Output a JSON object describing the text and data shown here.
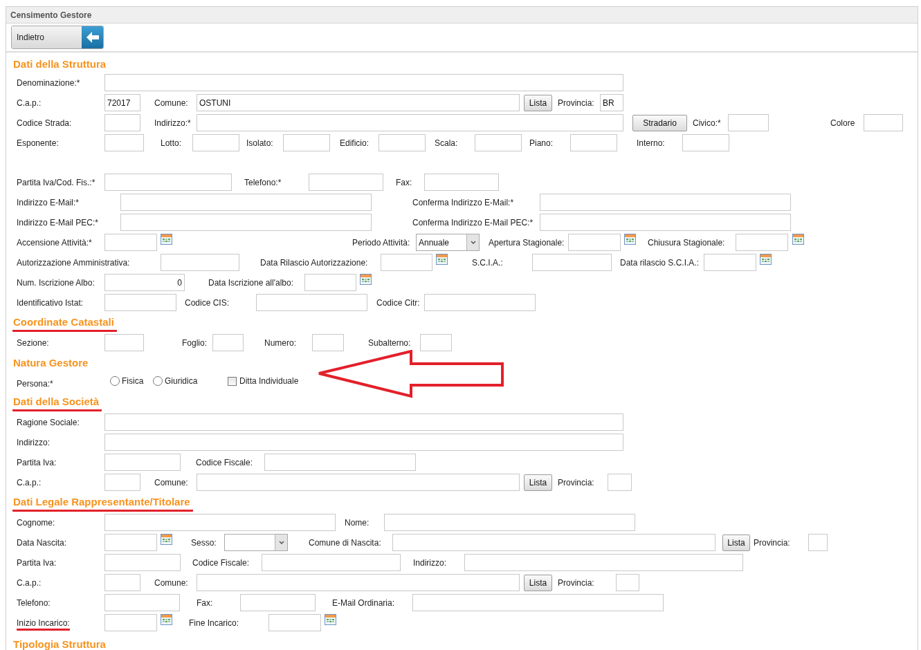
{
  "window": {
    "title": "Censimento Gestore"
  },
  "toolbar": {
    "back_button": "Indietro"
  },
  "sections": [
    {
      "title": "Dati della Struttura",
      "underlined": false,
      "rows": [
        {
          "items": [
            {
              "kind": "label",
              "text": "Denominazione:*",
              "underlined": false
            },
            {
              "kind": "input"
            }
          ]
        },
        {
          "items": [
            {
              "kind": "label",
              "text": "C.a.p.:",
              "underlined": false
            },
            {
              "kind": "input",
              "value": "72017"
            },
            {
              "kind": "label",
              "text": "Comune:",
              "underlined": false
            },
            {
              "kind": "input",
              "value": "OSTUNI"
            },
            {
              "kind": "button",
              "label": "Lista"
            },
            {
              "kind": "label",
              "text": "Provincia:",
              "underlined": false
            },
            {
              "kind": "input",
              "value": "BR"
            }
          ]
        },
        {
          "items": [
            {
              "kind": "label",
              "text": "Codice Strada:",
              "underlined": false
            },
            {
              "kind": "input"
            },
            {
              "kind": "label",
              "text": "Indirizzo:*",
              "underlined": false
            },
            {
              "kind": "input"
            },
            {
              "kind": "button",
              "label": "Stradario"
            },
            {
              "kind": "label",
              "text": "Civico:*",
              "underlined": false
            },
            {
              "kind": "input"
            },
            {
              "kind": "label",
              "text": "Colore",
              "underlined": false
            },
            {
              "kind": "input"
            }
          ]
        },
        {
          "items": [
            {
              "kind": "label",
              "text": "Esponente:",
              "underlined": false
            },
            {
              "kind": "input"
            },
            {
              "kind": "label",
              "text": "Lotto:",
              "underlined": false
            },
            {
              "kind": "input"
            },
            {
              "kind": "label",
              "text": "Isolato:",
              "underlined": false
            },
            {
              "kind": "input"
            },
            {
              "kind": "label",
              "text": "Edificio:",
              "underlined": false
            },
            {
              "kind": "input"
            },
            {
              "kind": "label",
              "text": "Scala:",
              "underlined": false
            },
            {
              "kind": "input"
            },
            {
              "kind": "label",
              "text": "Piano:",
              "underlined": false
            },
            {
              "kind": "input"
            },
            {
              "kind": "label",
              "text": "Interno:",
              "underlined": false
            },
            {
              "kind": "input"
            }
          ]
        },
        {
          "items": [
            {
              "kind": "label",
              "text": "Partita Iva/Cod. Fis.:*",
              "underlined": false
            },
            {
              "kind": "input"
            },
            {
              "kind": "label",
              "text": "Telefono:*",
              "underlined": false
            },
            {
              "kind": "input"
            },
            {
              "kind": "label",
              "text": "Fax:",
              "underlined": false
            },
            {
              "kind": "input"
            }
          ]
        },
        {
          "items": [
            {
              "kind": "label",
              "text": "Indirizzo E-Mail:*",
              "underlined": false
            },
            {
              "kind": "input"
            },
            {
              "kind": "label",
              "text": "Conferma Indirizzo E-Mail:*",
              "underlined": false
            },
            {
              "kind": "input"
            }
          ]
        },
        {
          "items": [
            {
              "kind": "label",
              "text": "Indirizzo E-Mail PEC:*",
              "underlined": false
            },
            {
              "kind": "input"
            },
            {
              "kind": "label",
              "text": "Conferma Indirizzo E-Mail PEC:*",
              "underlined": false
            },
            {
              "kind": "input"
            }
          ]
        },
        {
          "items": [
            {
              "kind": "label",
              "text": "Accensione Attività:*",
              "underlined": false
            },
            {
              "kind": "input"
            },
            {
              "kind": "calendar"
            },
            {
              "kind": "label",
              "text": "Periodo Attività:",
              "underlined": false
            },
            {
              "kind": "select",
              "value": "Annuale"
            },
            {
              "kind": "label",
              "text": "Apertura Stagionale:",
              "underlined": false
            },
            {
              "kind": "input"
            },
            {
              "kind": "calendar"
            },
            {
              "kind": "label",
              "text": "Chiusura Stagionale:",
              "underlined": false
            },
            {
              "kind": "input"
            },
            {
              "kind": "calendar"
            }
          ]
        },
        {
          "items": [
            {
              "kind": "label",
              "text": "Autorizzazione Amministrativa:",
              "underlined": false
            },
            {
              "kind": "input"
            },
            {
              "kind": "label",
              "text": "Data Rilascio Autorizzazione:",
              "underlined": false
            },
            {
              "kind": "input"
            },
            {
              "kind": "calendar"
            },
            {
              "kind": "label",
              "text": "S.C.I.A.:",
              "underlined": false
            },
            {
              "kind": "input"
            },
            {
              "kind": "label",
              "text": "Data rilascio S.C.I.A.:",
              "underlined": false
            },
            {
              "kind": "input"
            },
            {
              "kind": "calendar"
            }
          ]
        },
        {
          "items": [
            {
              "kind": "label",
              "text": "Num. Iscrizione Albo:",
              "underlined": false
            },
            {
              "kind": "input",
              "value": "0",
              "numeric": true
            },
            {
              "kind": "label",
              "text": "Data Iscrizione all'albo:",
              "underlined": false
            },
            {
              "kind": "input"
            },
            {
              "kind": "calendar"
            }
          ]
        },
        {
          "items": [
            {
              "kind": "label",
              "text": "Identificativo Istat:",
              "underlined": false
            },
            {
              "kind": "input"
            },
            {
              "kind": "label",
              "text": "Codice CIS:",
              "underlined": false
            },
            {
              "kind": "input"
            },
            {
              "kind": "label",
              "text": "Codice Citr:",
              "underlined": false
            },
            {
              "kind": "input"
            }
          ]
        }
      ]
    },
    {
      "title": "Coordinate Catastali",
      "underlined": true,
      "rows": [
        {
          "items": [
            {
              "kind": "label",
              "text": "Sezione:",
              "underlined": false
            },
            {
              "kind": "input"
            },
            {
              "kind": "label",
              "text": "Foglio:",
              "underlined": false
            },
            {
              "kind": "input"
            },
            {
              "kind": "label",
              "text": "Numero:",
              "underlined": false
            },
            {
              "kind": "input"
            },
            {
              "kind": "label",
              "text": "Subalterno:",
              "underlined": false
            },
            {
              "kind": "input"
            }
          ]
        }
      ]
    },
    {
      "title": "Natura Gestore",
      "underlined": false,
      "rows": [
        {
          "pointer_arrow": true,
          "items": [
            {
              "kind": "label",
              "text": "Persona:*",
              "underlined": false
            },
            {
              "kind": "radio",
              "label": "Fisica",
              "selected": false
            },
            {
              "kind": "radio",
              "label": "Giuridica",
              "selected": false
            },
            {
              "kind": "checkbox",
              "label": "Ditta Individuale",
              "checked": false
            }
          ]
        }
      ]
    },
    {
      "title": "Dati della Società",
      "underlined": true,
      "rows": [
        {
          "items": [
            {
              "kind": "label",
              "text": "Ragione Sociale:",
              "underlined": false
            },
            {
              "kind": "input"
            }
          ]
        },
        {
          "items": [
            {
              "kind": "label",
              "text": "Indirizzo:",
              "underlined": false
            },
            {
              "kind": "input"
            }
          ]
        },
        {
          "items": [
            {
              "kind": "label",
              "text": "Partita Iva:",
              "underlined": false
            },
            {
              "kind": "input"
            },
            {
              "kind": "label",
              "text": "Codice Fiscale:",
              "underlined": false
            },
            {
              "kind": "input"
            }
          ]
        },
        {
          "items": [
            {
              "kind": "label",
              "text": "C.a.p.:",
              "underlined": false
            },
            {
              "kind": "input"
            },
            {
              "kind": "label",
              "text": "Comune:",
              "underlined": false
            },
            {
              "kind": "input"
            },
            {
              "kind": "button",
              "label": "Lista"
            },
            {
              "kind": "label",
              "text": "Provincia:",
              "underlined": false
            },
            {
              "kind": "input"
            }
          ]
        }
      ]
    },
    {
      "title": "Dati Legale Rappresentante/Titolare",
      "underlined": true,
      "rows": [
        {
          "items": [
            {
              "kind": "label",
              "text": "Cognome:",
              "underlined": false
            },
            {
              "kind": "input"
            },
            {
              "kind": "label",
              "text": "Nome:",
              "underlined": false
            },
            {
              "kind": "input"
            }
          ]
        },
        {
          "items": [
            {
              "kind": "label",
              "text": "Data Nascita:",
              "underlined": false
            },
            {
              "kind": "input"
            },
            {
              "kind": "calendar"
            },
            {
              "kind": "label",
              "text": "Sesso:",
              "underlined": false
            },
            {
              "kind": "select"
            },
            {
              "kind": "label",
              "text": "Comune di Nascita:",
              "underlined": false
            },
            {
              "kind": "input"
            },
            {
              "kind": "button",
              "label": "Lista"
            },
            {
              "kind": "label",
              "text": "Provincia:",
              "underlined": false
            },
            {
              "kind": "input"
            }
          ]
        },
        {
          "items": [
            {
              "kind": "label",
              "text": "Partita Iva:",
              "underlined": false
            },
            {
              "kind": "input"
            },
            {
              "kind": "label",
              "text": "Codice Fiscale:",
              "underlined": false
            },
            {
              "kind": "input"
            },
            {
              "kind": "label",
              "text": "Indirizzo:",
              "underlined": false
            },
            {
              "kind": "input"
            }
          ]
        },
        {
          "items": [
            {
              "kind": "label",
              "text": "C.a.p.:",
              "underlined": false
            },
            {
              "kind": "input"
            },
            {
              "kind": "label",
              "text": "Comune:",
              "underlined": false
            },
            {
              "kind": "input"
            },
            {
              "kind": "button",
              "label": "Lista"
            },
            {
              "kind": "label",
              "text": "Provincia:",
              "underlined": false
            },
            {
              "kind": "input"
            }
          ]
        },
        {
          "items": [
            {
              "kind": "label",
              "text": "Telefono:",
              "underlined": false
            },
            {
              "kind": "input"
            },
            {
              "kind": "label",
              "text": "Fax:",
              "underlined": false
            },
            {
              "kind": "input"
            },
            {
              "kind": "label",
              "text": "E-Mail Ordinaria:",
              "underlined": false
            },
            {
              "kind": "input"
            }
          ]
        },
        {
          "items": [
            {
              "kind": "label",
              "text": "Inizio Incarico:",
              "underlined": true
            },
            {
              "kind": "input"
            },
            {
              "kind": "calendar"
            },
            {
              "kind": "label",
              "text": "Fine Incarico:",
              "underlined": false
            },
            {
              "kind": "input"
            },
            {
              "kind": "calendar"
            }
          ]
        }
      ]
    },
    {
      "title": "Tipologia Struttura",
      "underlined": false
    }
  ]
}
